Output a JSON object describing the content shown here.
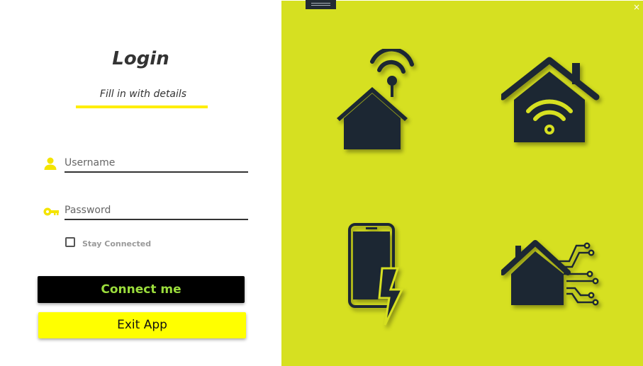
{
  "login": {
    "title": "Login",
    "subtitle": "Fill in with details",
    "username": {
      "placeholder": "Username",
      "value": "",
      "icon": "user-icon"
    },
    "password": {
      "placeholder": "Password",
      "value": "",
      "icon": "key-icon"
    },
    "stay_connected": {
      "label": "Stay Connected",
      "checked": false
    },
    "connect_label": "Connect me",
    "exit_label": "Exit App"
  },
  "window": {
    "close_glyph": "×"
  },
  "illustrations": [
    {
      "icon": "smart-home-antenna-icon"
    },
    {
      "icon": "home-wifi-icon"
    },
    {
      "icon": "smartphone-charging-icon"
    },
    {
      "icon": "home-circuit-icon"
    }
  ],
  "colors": {
    "accent_yellow": "#ffff00",
    "panel_green": "#d6e021",
    "connect_text": "#9bdd3c",
    "icon_dark": "#1c2733"
  }
}
